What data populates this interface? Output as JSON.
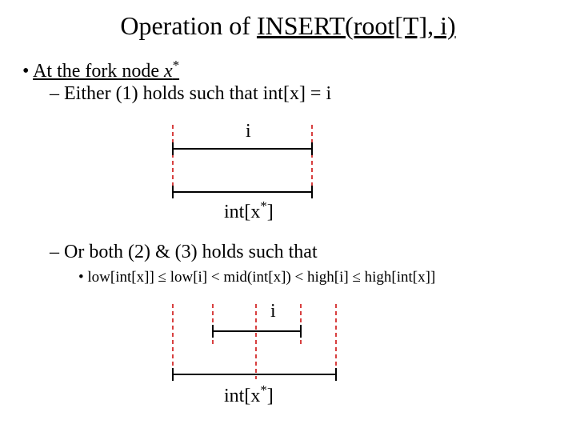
{
  "title": {
    "prefix": "Operation of ",
    "underlined": "INSERT(root[T], i)"
  },
  "bullet1": {
    "prefix": "At the fork node ",
    "xstar": "x",
    "star": "*"
  },
  "sub1": "– Either (1) holds such that int[x] = i",
  "sub2": "– Or both (2) & (3) holds such that",
  "sub2b": "• low[int[x]] ≤ low[i] < mid(int[x]) < high[i] ≤ high[int[x]]",
  "labels": {
    "i": "i",
    "intx_pre": "int[x",
    "intx_star": "*",
    "intx_post": "]"
  }
}
